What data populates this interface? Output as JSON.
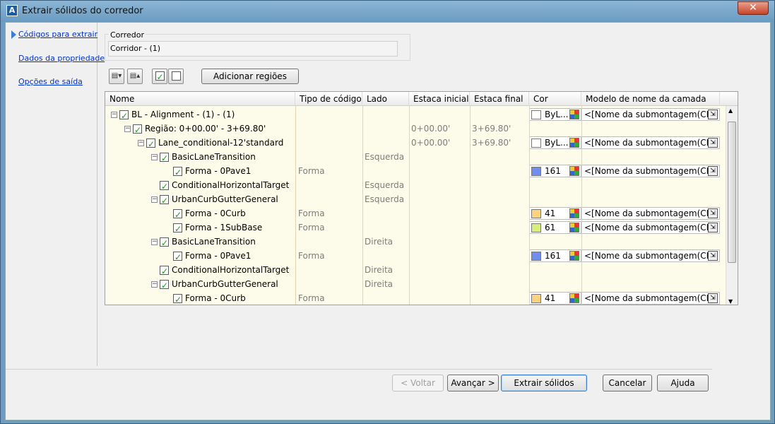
{
  "window": {
    "title": "Extrair sólidos do corredor",
    "close": "✕"
  },
  "nav": [
    {
      "label": "Códigos para extrair"
    },
    {
      "label": "Dados da propriedade"
    },
    {
      "label": "Opções de saída"
    }
  ],
  "corridor": {
    "group_label": "Corredor",
    "value": "Corridor - (1)"
  },
  "toolbar": {
    "add_regions": "Adicionar regiões"
  },
  "grid": {
    "headers": [
      "Nome",
      "Tipo de código",
      "Lado",
      "Estaca inicial",
      "Estaca final",
      "Cor",
      "Modelo de nome da camada"
    ],
    "rows": [
      {
        "name": "BL - Alignment - (1) - (1)",
        "code": "",
        "side": "",
        "start": "",
        "end": "",
        "color": "ByL...",
        "layer": "<[Nome da submontagem(CP..."
      },
      {
        "name": "Região: 0+00.00' - 3+69.80'",
        "code": "",
        "side": "",
        "start": "0+00.00'",
        "end": "3+69.80'",
        "color": "",
        "layer": ""
      },
      {
        "name": "Lane_conditional-12'standard",
        "code": "",
        "side": "",
        "start": "0+00.00'",
        "end": "3+69.80'",
        "color": "ByL...",
        "layer": "<[Nome da submontagem(CP..."
      },
      {
        "name": "BasicLaneTransition",
        "code": "",
        "side": "Esquerda",
        "start": "",
        "end": "",
        "color": "",
        "layer": ""
      },
      {
        "name": "Forma - 0Pave1",
        "code": "Forma",
        "side": "",
        "start": "",
        "end": "",
        "color": "161",
        "layer": "<[Nome da submontagem(CP..."
      },
      {
        "name": "ConditionalHorizontalTarget",
        "code": "",
        "side": "Esquerda",
        "start": "",
        "end": "",
        "color": "",
        "layer": ""
      },
      {
        "name": "UrbanCurbGutterGeneral",
        "code": "",
        "side": "Esquerda",
        "start": "",
        "end": "",
        "color": "",
        "layer": ""
      },
      {
        "name": "Forma - 0Curb",
        "code": "Forma",
        "side": "",
        "start": "",
        "end": "",
        "color": "41",
        "layer": "<[Nome da submontagem(CP..."
      },
      {
        "name": "Forma - 1SubBase",
        "code": "Forma",
        "side": "",
        "start": "",
        "end": "",
        "color": "61",
        "layer": "<[Nome da submontagem(CP..."
      },
      {
        "name": "BasicLaneTransition",
        "code": "",
        "side": "Direita",
        "start": "",
        "end": "",
        "color": "",
        "layer": ""
      },
      {
        "name": "Forma - 0Pave1",
        "code": "Forma",
        "side": "",
        "start": "",
        "end": "",
        "color": "161",
        "layer": "<[Nome da submontagem(CP..."
      },
      {
        "name": "ConditionalHorizontalTarget",
        "code": "",
        "side": "Direita",
        "start": "",
        "end": "",
        "color": "",
        "layer": ""
      },
      {
        "name": "UrbanCurbGutterGeneral",
        "code": "",
        "side": "Direita",
        "start": "",
        "end": "",
        "color": "",
        "layer": ""
      },
      {
        "name": "Forma - 0Curb",
        "code": "Forma",
        "side": "",
        "start": "",
        "end": "",
        "color": "41",
        "layer": "<[Nome da submontagem(CP..."
      }
    ],
    "swatches": {
      "ByL...": "#ffffff",
      "161": "#6f8ef0",
      "41": "#ffd27f",
      "61": "#d4f07a"
    }
  },
  "buttons": {
    "back": "< Voltar",
    "next": "Avançar >",
    "extract": "Extrair sólidos",
    "cancel": "Cancelar",
    "help": "Ajuda"
  }
}
